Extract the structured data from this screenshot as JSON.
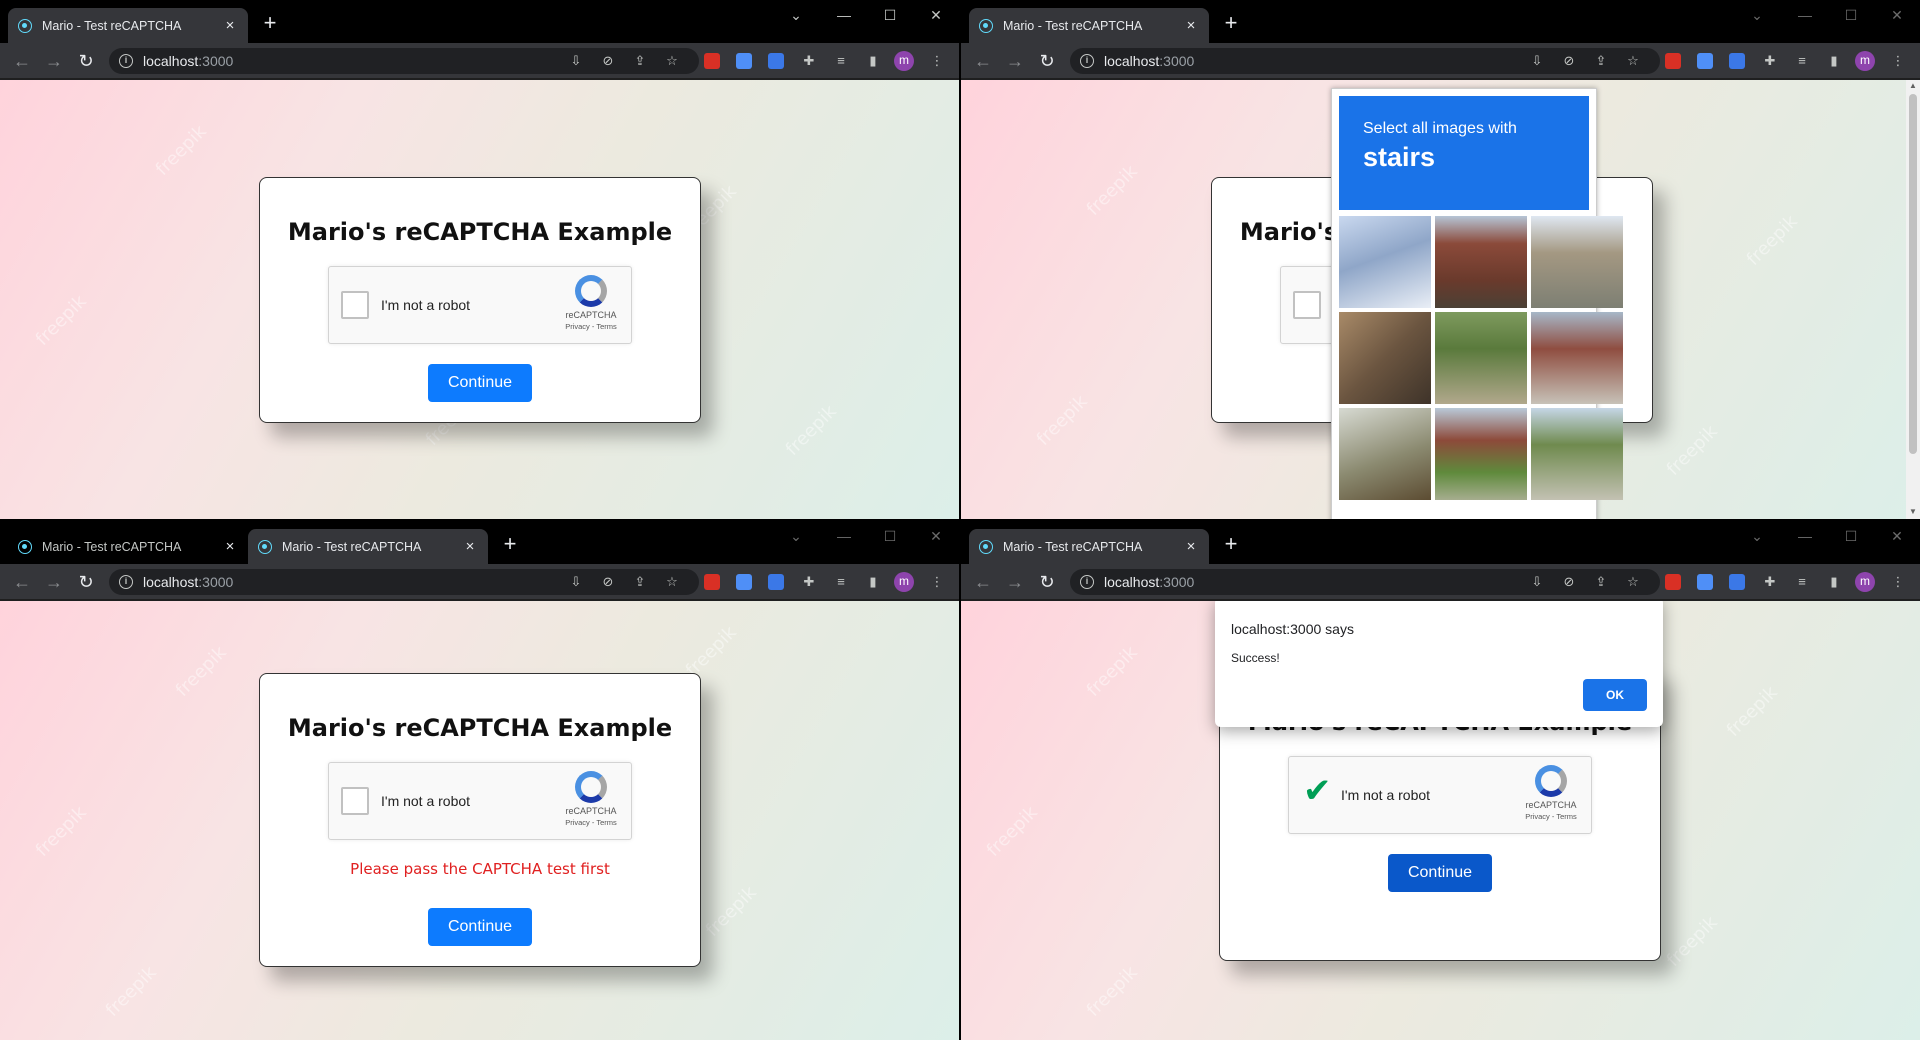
{
  "browser": {
    "tab_title": "Mario - Test reCAPTCHA",
    "new_tab_label": "+",
    "url_host": "localhost",
    "url_port": ":3000",
    "profile_initial": "m"
  },
  "page": {
    "title": "Mario's reCAPTCHA Example",
    "continue_label": "Continue",
    "error_message": "Please pass the CAPTCHA test first"
  },
  "recaptcha": {
    "label": "I'm not a robot",
    "brand": "reCAPTCHA",
    "links": "Privacy - Terms"
  },
  "challenge": {
    "instruction": "Select all images with",
    "target": "stairs"
  },
  "alert": {
    "title": "localhost:3000 says",
    "message": "Success!",
    "ok_label": "OK"
  },
  "watermark": "freepik",
  "colors": {
    "accent": "#0d7bfe",
    "error": "#e02020",
    "challenge_header": "#1a73e8",
    "check": "#009e55"
  }
}
